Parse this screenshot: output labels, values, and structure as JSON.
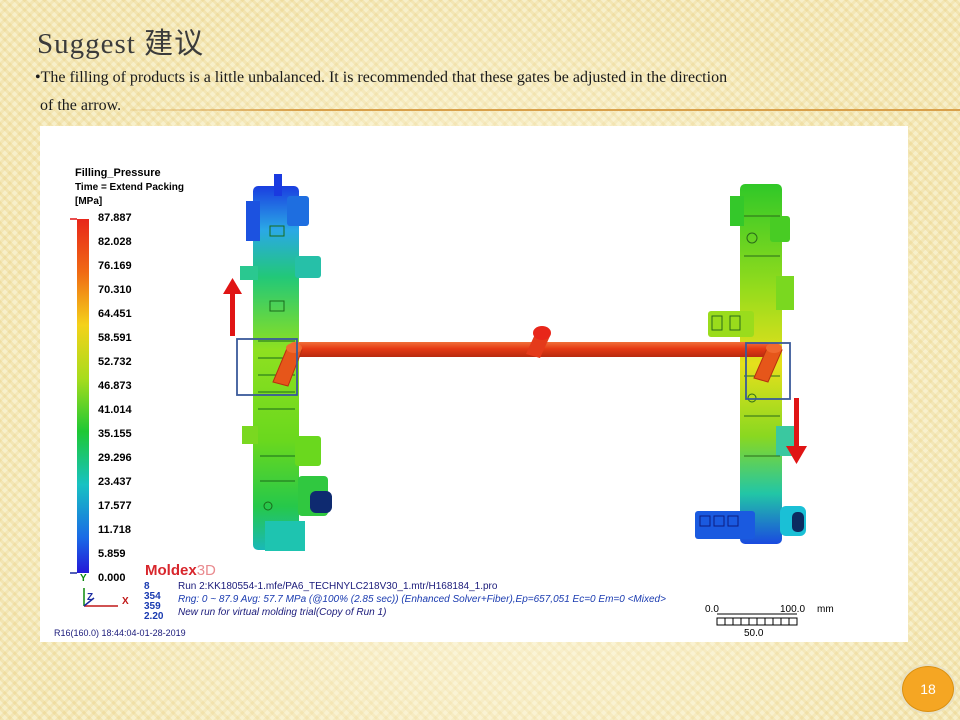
{
  "slide": {
    "title": "Suggest 建议",
    "bullet_line1": "•The filling of products is a little unbalanced. It is recommended that these gates be adjusted in the direction",
    "bullet_line2": "of the arrow.",
    "page_number": "18"
  },
  "result": {
    "legend": {
      "title": "Filling_Pressure",
      "time": "Time =  Extend Packing",
      "unit": "[MPa]",
      "ticks": [
        "87.887",
        "82.028",
        "76.169",
        "70.310",
        "64.451",
        "58.591",
        "52.732",
        "46.873",
        "41.014",
        "35.155",
        "29.296",
        "23.437",
        "17.577",
        "11.718",
        "5.859",
        "0.000"
      ]
    },
    "brand": {
      "name": "Moldex",
      "suffix": "3D"
    },
    "run": {
      "numbers": [
        "8",
        "354",
        "359",
        "2.20"
      ],
      "file_line": "Run 2:KK180554-1.mfe/PA6_TECHNYLC218V30_1.mtr/H168184_1.pro",
      "range_line": "Rng: 0 ~ 87.9   Avg: 57.7 MPa  (@100% (2.85 sec)) (Enhanced Solver+Fiber),Ep=657,051 Ec=0 Em=0  <Mixed>",
      "note_line": "New run for virtual molding trial(Copy of Run 1)",
      "stamp": "R16(160.0) 18:44:04-01-28-2019"
    },
    "axes": {
      "y": "Y",
      "z": "Z",
      "x": "X"
    },
    "scale": {
      "start": "0.0",
      "end": "100.0",
      "unit": "mm",
      "mid": "50.0"
    }
  },
  "colors": {
    "accent_orange": "#f5a623",
    "arrow_red": "#e01414",
    "runner_red": "#e0401a",
    "highlight_box": "#3a5a9a"
  }
}
